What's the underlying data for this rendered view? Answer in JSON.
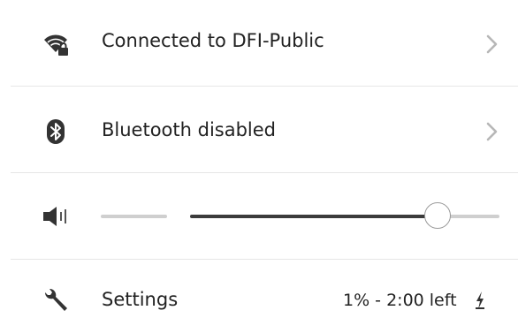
{
  "network": {
    "label": "Connected to DFI-Public",
    "icon": "wifi-locked-icon"
  },
  "bluetooth": {
    "label": "Bluetooth disabled",
    "icon": "bluetooth-icon"
  },
  "volume": {
    "icon": "speaker-icon",
    "level": 0.8
  },
  "footer": {
    "settings_label": "Settings",
    "battery_status": "1% - 2:00 left",
    "settings_icon": "wrench-icon",
    "battery_icon": "battery-charging-icon"
  },
  "colors": {
    "text": "#222222",
    "icon": "#333333",
    "track_filled": "#3c3c3c",
    "track_empty": "#cfcfcf",
    "chevron": "#b7b7b7",
    "divider": "#e6e6e6"
  }
}
